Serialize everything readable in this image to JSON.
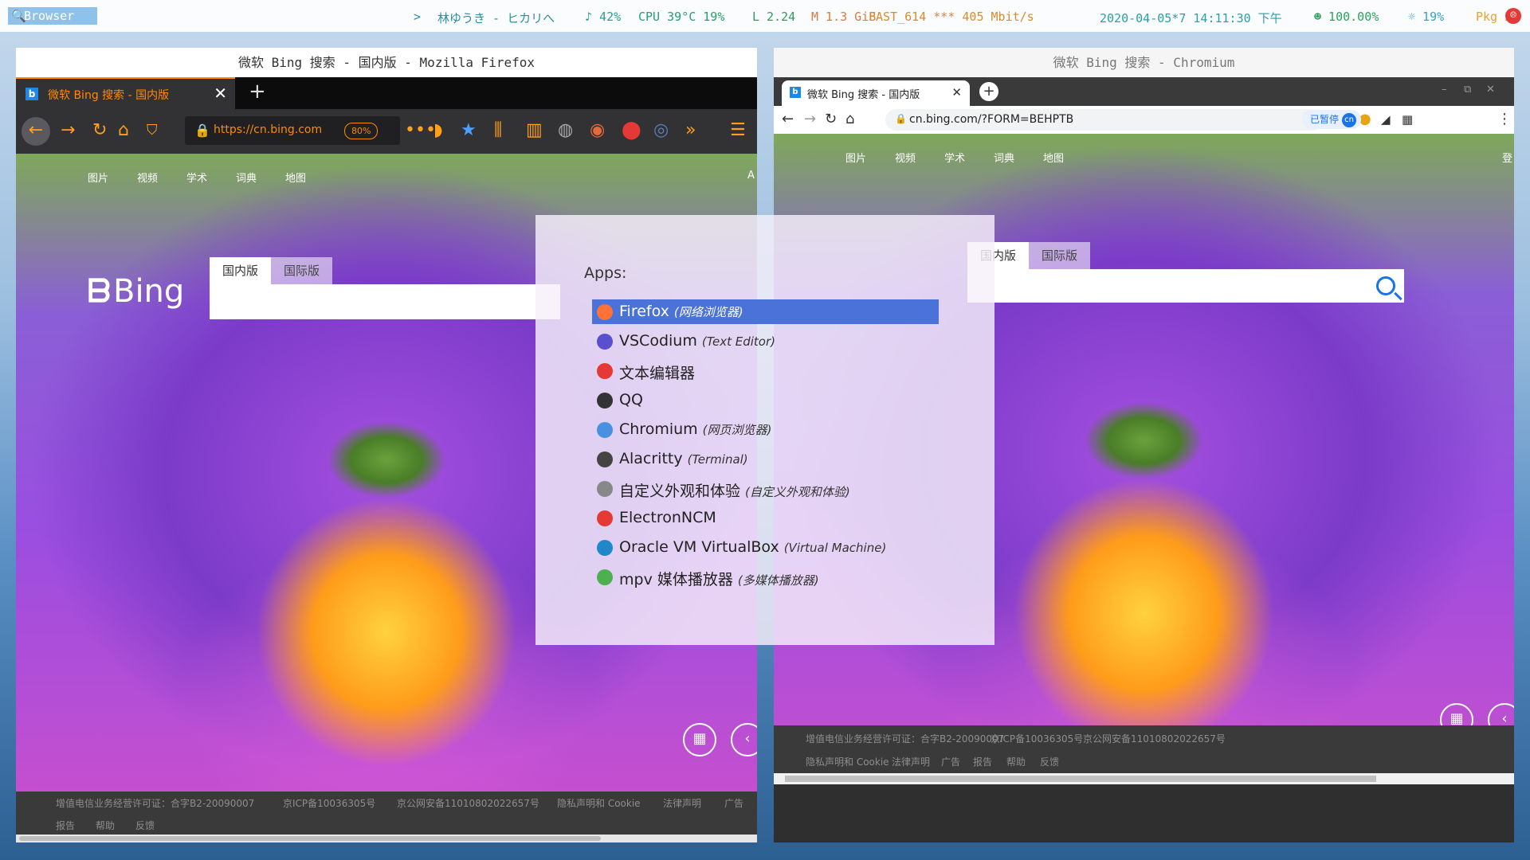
{
  "statusbar": {
    "workspace": "Browser",
    "arrow": ">",
    "song": "林ゆうき - ヒカリへ",
    "volume": "♪ 42%",
    "cpu": "CPU 39°C  19%",
    "load": "L 2.24",
    "memory": "M 1.3 GiB",
    "network": "FAST_614 *** 405 Mbit/s",
    "datetime": "2020-04-05*7 14:11:30 下午",
    "battery": "☻ 100.00%",
    "brightness": "☼ 19%",
    "packages": "Pkg 2"
  },
  "firefox": {
    "window_title": "微软 Bing 搜索 - 国内版 - Mozilla Firefox",
    "tab_title": "微软 Bing 搜索 - 国内版",
    "url": "https://cn.bing.com",
    "zoom": "80%",
    "accent": "#ff8a00"
  },
  "chromium": {
    "window_title": "微软 Bing 搜索 - Chromium",
    "tab_title": "微软 Bing 搜索 - 国内版",
    "url": "cn.bing.com/?FORM=BEHPTB",
    "paused_label": "已暂停",
    "avatar": "cn"
  },
  "bing": {
    "nav": [
      "图片",
      "视频",
      "学术",
      "词典",
      "地图"
    ],
    "login_ff": "A",
    "login_cr": "登",
    "logo": "Bing",
    "tab_cn": "国内版",
    "tab_intl": "国际版",
    "ff_footer": [
      "增值电信业务经营许可证：合字B2-20090007",
      "京ICP备10036305号",
      "京公网安备11010802022657号",
      "隐私声明和 Cookie",
      "法律声明",
      "广告",
      "报告",
      "帮助",
      "反馈"
    ],
    "cr_footer": [
      "增值电信业务经营许可证：合字B2-20090007",
      "京ICP备10036305号",
      "京公网安备11010802022657号",
      "隐私声明和 Cookie",
      "法律声明",
      "广告",
      "报告",
      "帮助",
      "反馈"
    ]
  },
  "launcher": {
    "prompt": "Apps:",
    "apps": [
      {
        "name": "Firefox",
        "desc": "(网络浏览器)",
        "color": "#ff7139"
      },
      {
        "name": "VSCodium",
        "desc": "(Text Editor)",
        "color": "#5a4fcf"
      },
      {
        "name": "文本编辑器",
        "desc": "",
        "color": "#e53935"
      },
      {
        "name": "QQ",
        "desc": "",
        "color": "#333333"
      },
      {
        "name": "Chromium",
        "desc": "(网页浏览器)",
        "color": "#4a90e2"
      },
      {
        "name": "Alacritty",
        "desc": "(Terminal)",
        "color": "#444444"
      },
      {
        "name": "自定义外观和体验",
        "desc": "(自定义外观和体验)",
        "color": "#888888"
      },
      {
        "name": "ElectronNCM",
        "desc": "",
        "color": "#e53935"
      },
      {
        "name": "Oracle VM VirtualBox",
        "desc": "(Virtual Machine)",
        "color": "#1e88c8"
      },
      {
        "name": "mpv 媒体播放器",
        "desc": "(多媒体播放器)",
        "color": "#4caf50"
      }
    ]
  }
}
